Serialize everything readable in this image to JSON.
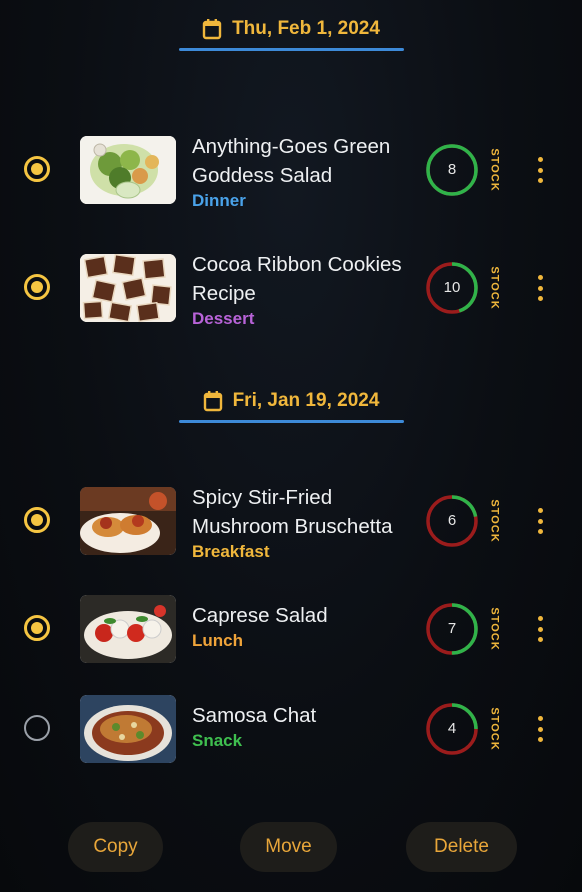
{
  "groups": [
    {
      "date": "Thu, Feb 1, 2024",
      "items": [
        {
          "title_line1": "Anything-Goes Green",
          "title_line2": "Goddess Salad",
          "category": "Dinner",
          "category_color": "#4aa3ea",
          "count": "8",
          "ring_fraction": 1.0,
          "selected": true,
          "image_icon": "green-salad-photo"
        },
        {
          "title_line1": "Cocoa Ribbon Cookies",
          "title_line2": "Recipe",
          "category": "Dessert",
          "category_color": "#b863d8",
          "count": "10",
          "ring_fraction": 0.45,
          "selected": true,
          "image_icon": "cookies-photo"
        }
      ]
    },
    {
      "date": "Fri, Jan 19, 2024",
      "items": [
        {
          "title_line1": "Spicy Stir-Fried",
          "title_line2": "Mushroom Bruschetta",
          "category": "Breakfast",
          "category_color": "#f0b73c",
          "count": "6",
          "ring_fraction": 0.22,
          "selected": true,
          "image_icon": "bruschetta-photo"
        },
        {
          "title_line1": "Caprese Salad",
          "title_line2": "",
          "category": "Lunch",
          "category_color": "#f0a43a",
          "count": "7",
          "ring_fraction": 0.5,
          "selected": true,
          "image_icon": "caprese-photo"
        },
        {
          "title_line1": "Samosa Chat",
          "title_line2": "",
          "category": "Snack",
          "category_color": "#3fbf4f",
          "count": "4",
          "ring_fraction": 0.25,
          "selected": false,
          "image_icon": "samosa-chat-photo"
        }
      ]
    }
  ],
  "stock_label": "STOCK",
  "actions": {
    "copy": "Copy",
    "move": "Move",
    "delete": "Delete"
  },
  "colors": {
    "accent": "#f0b73c",
    "ring_green": "#2fb34a",
    "ring_red": "#9b1c1c",
    "divider": "#3d8ad8"
  }
}
